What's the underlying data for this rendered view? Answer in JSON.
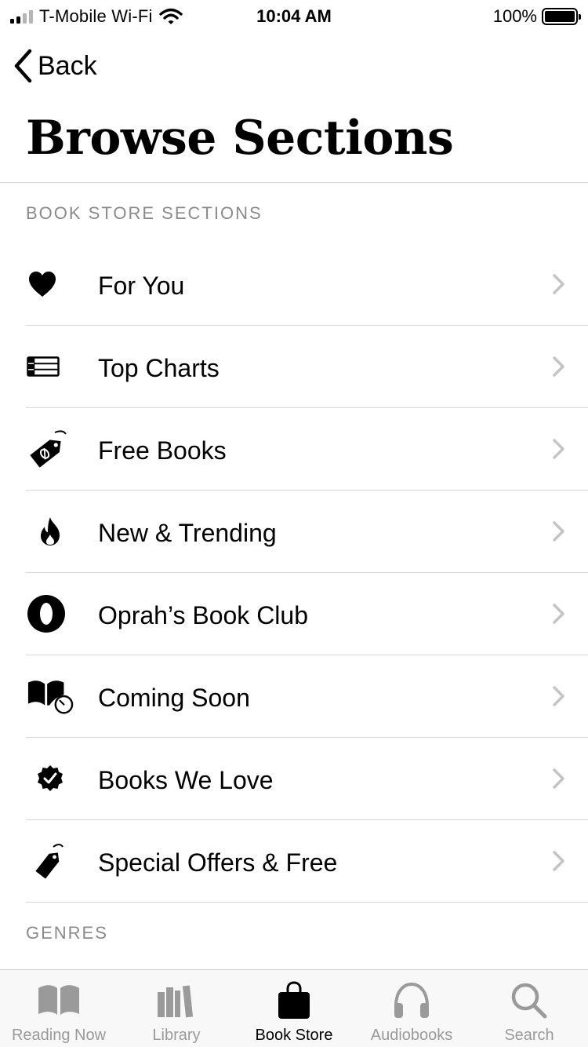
{
  "status_bar": {
    "carrier": "T-Mobile Wi-Fi",
    "time": "10:04 AM",
    "battery": "100%",
    "signal_bars_active": 2,
    "signal_bars_total": 4
  },
  "nav": {
    "back_label": "Back"
  },
  "page": {
    "title": "Browse Sections"
  },
  "sections": {
    "bookstore_header": "BOOK STORE SECTIONS",
    "genres_header": "GENRES"
  },
  "items": [
    {
      "label": "For You",
      "icon": "heart-icon"
    },
    {
      "label": "Top Charts",
      "icon": "list-icon"
    },
    {
      "label": "Free Books",
      "icon": "price-tag-zero-icon"
    },
    {
      "label": "New & Trending",
      "icon": "flame-icon"
    },
    {
      "label": "Oprah’s Book Club",
      "icon": "oprah-logo-icon"
    },
    {
      "label": "Coming Soon",
      "icon": "book-clock-icon"
    },
    {
      "label": "Books We Love",
      "icon": "checkmark-seal-icon"
    },
    {
      "label": "Special Offers & Free",
      "icon": "tag-icon"
    }
  ],
  "tabs": [
    {
      "label": "Reading Now",
      "icon": "open-book-icon",
      "active": false
    },
    {
      "label": "Library",
      "icon": "books-icon",
      "active": false
    },
    {
      "label": "Book Store",
      "icon": "shopping-bag-icon",
      "active": true
    },
    {
      "label": "Audiobooks",
      "icon": "headphones-icon",
      "active": false
    },
    {
      "label": "Search",
      "icon": "magnifier-icon",
      "active": false
    }
  ],
  "colors": {
    "text": "#000000",
    "secondary": "#8a8a8a",
    "chevron": "#c4c4c8",
    "divider": "#d6d6d6",
    "tab_inactive": "#9a9a9a",
    "tab_bar_bg": "#f8f8f8"
  }
}
